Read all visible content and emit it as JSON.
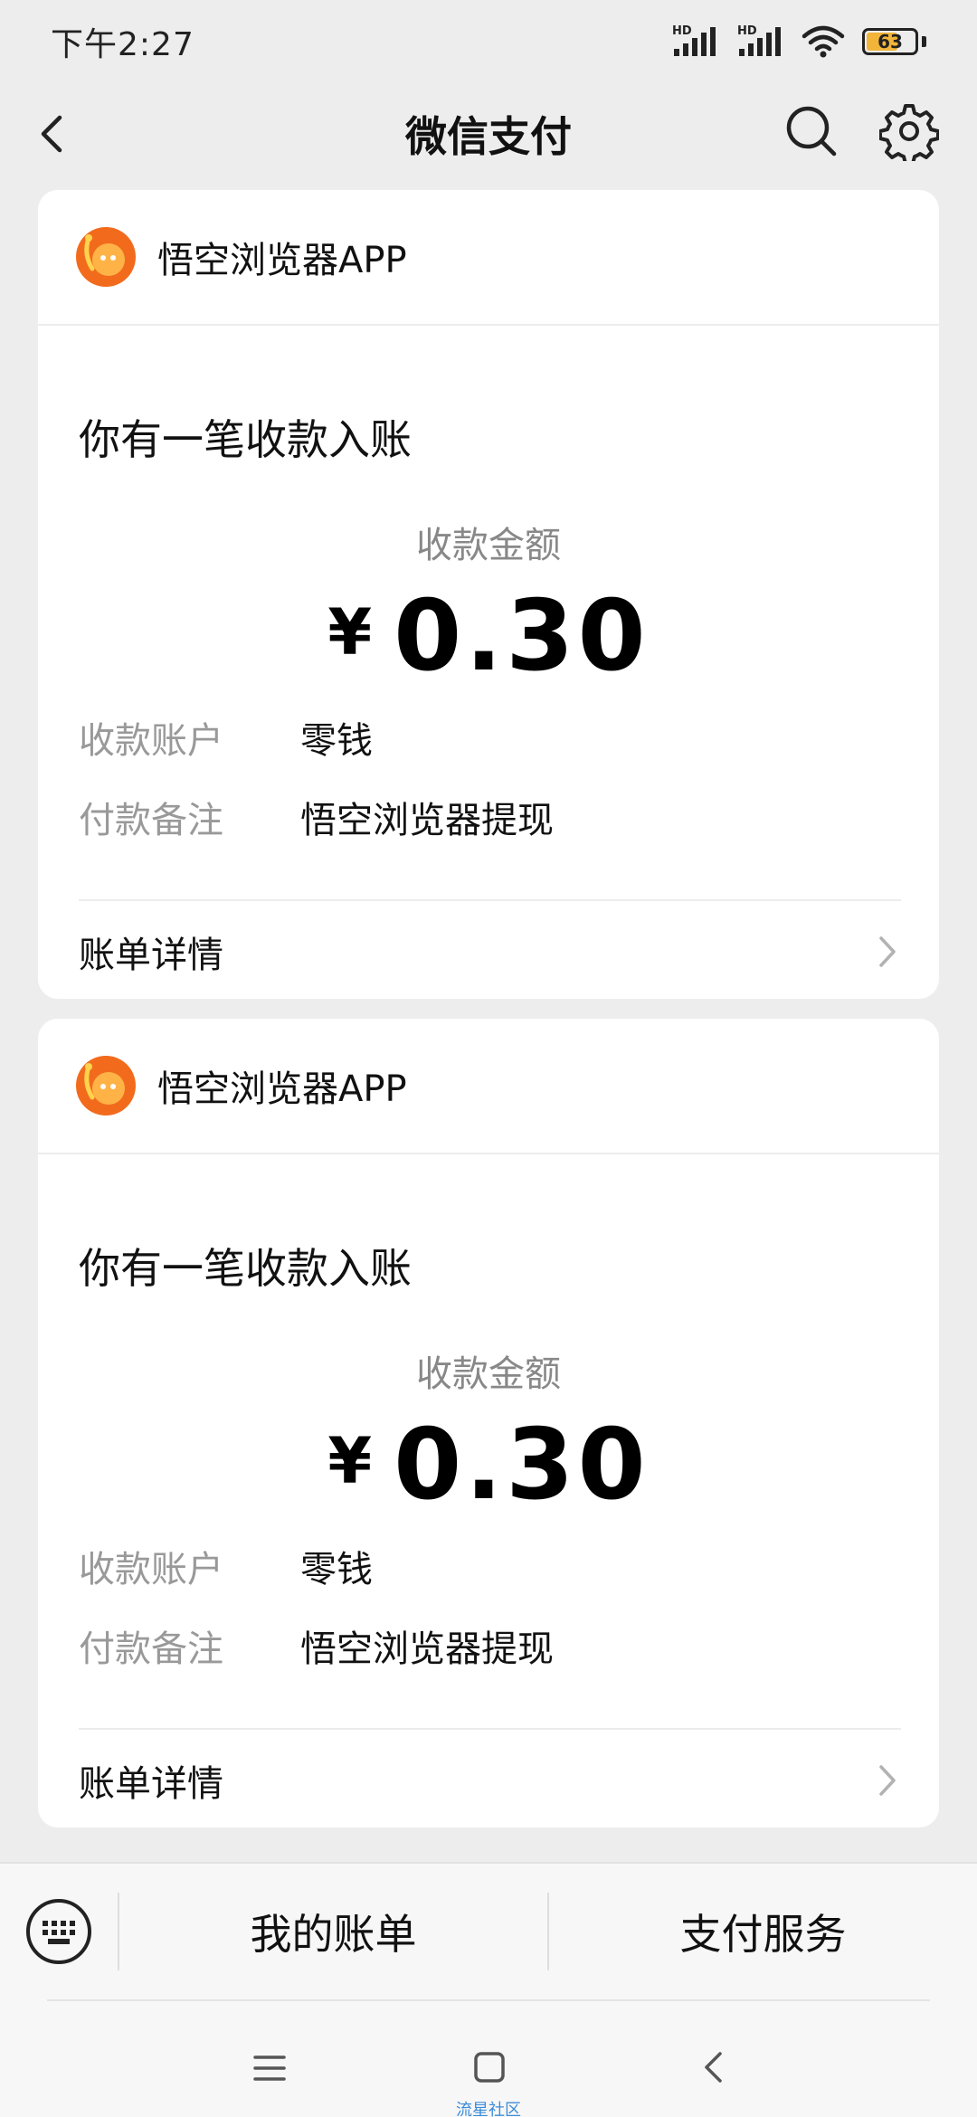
{
  "status_bar": {
    "time": "下午2:27",
    "signal1_label": "HD",
    "signal2_label": "HD",
    "battery_level": "63"
  },
  "nav": {
    "title": "微信支付"
  },
  "cards": [
    {
      "merchant": "悟空浏览器APP",
      "title": "你有一笔收款入账",
      "amount_label": "收款金额",
      "currency": "¥",
      "amount": "0.30",
      "account_label": "收款账户",
      "account_value": "零钱",
      "remark_label": "付款备注",
      "remark_value": "悟空浏览器提现",
      "detail_label": "账单详情"
    },
    {
      "merchant": "悟空浏览器APP",
      "title": "你有一笔收款入账",
      "amount_label": "收款金额",
      "currency": "¥",
      "amount": "0.30",
      "account_label": "收款账户",
      "account_value": "零钱",
      "remark_label": "付款备注",
      "remark_value": "悟空浏览器提现",
      "detail_label": "账单详情"
    }
  ],
  "bottom_menu": {
    "item1": "我的账单",
    "item2": "支付服务"
  },
  "watermark": "流星社区",
  "colors": {
    "background": "#ededed",
    "card": "#ffffff",
    "battery": "#f2b53a",
    "logo_orange": "#f26b1d"
  },
  "icons": {
    "back": "chevron-left-icon",
    "search": "search-icon",
    "settings": "gear-icon",
    "keyboard": "keyboard-icon"
  }
}
